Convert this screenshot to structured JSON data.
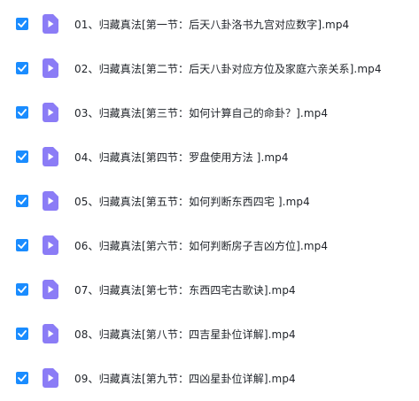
{
  "accent_color": "#1a8cff",
  "file_icon_color": "#8b7cf6",
  "files": [
    {
      "checked": true,
      "icon": "video-file-icon",
      "name": "01、归藏真法[第一节：后天八卦洛书九宫对应数字].mp4"
    },
    {
      "checked": true,
      "icon": "video-file-icon",
      "name": "02、归藏真法[第二节：后天八卦对应方位及家庭六亲关系].mp4"
    },
    {
      "checked": true,
      "icon": "video-file-icon",
      "name": "03、归藏真法[第三节：如何计算自己的命卦？].mp4"
    },
    {
      "checked": true,
      "icon": "video-file-icon",
      "name": "04、归藏真法[第四节：罗盘使用方法 ].mp4"
    },
    {
      "checked": true,
      "icon": "video-file-icon",
      "name": "05、归藏真法[第五节：如何判断东西四宅 ].mp4"
    },
    {
      "checked": true,
      "icon": "video-file-icon",
      "name": "06、归藏真法[第六节：如何判断房子吉凶方位].mp4"
    },
    {
      "checked": true,
      "icon": "video-file-icon",
      "name": "07、归藏真法[第七节：东西四宅古歌诀].mp4"
    },
    {
      "checked": true,
      "icon": "video-file-icon",
      "name": "08、归藏真法[第八节：四吉星卦位详解].mp4"
    },
    {
      "checked": true,
      "icon": "video-file-icon",
      "name": "09、归藏真法[第九节：四凶星卦位详解].mp4"
    }
  ]
}
